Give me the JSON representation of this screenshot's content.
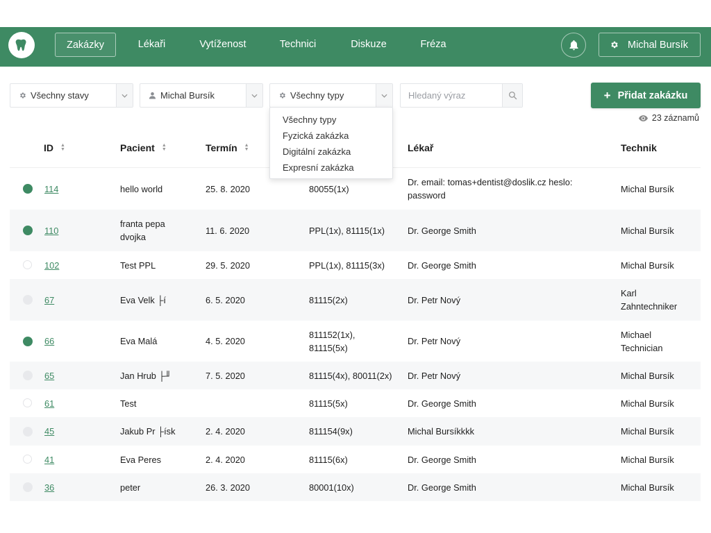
{
  "nav": {
    "logo_icon": "tooth-icon",
    "items": [
      "Zakázky",
      "Lékaři",
      "Vytíženost",
      "Technici",
      "Diskuze",
      "Fréza"
    ],
    "active_index": 0,
    "user": "Michal Bursík"
  },
  "filters": {
    "status": "Všechny stavy",
    "doctor": "Michal Bursík",
    "type": "Všechny typy",
    "search_placeholder": "Hledaný výraz",
    "add_button": "Přidat zakázku",
    "records": "23 záznamů"
  },
  "type_dropdown": {
    "open": true,
    "options": [
      "Všechny typy",
      "Fyzická zakázka",
      "Digitální zakázka",
      "Expresní zakázka"
    ]
  },
  "table": {
    "columns": [
      "ID",
      "Pacient",
      "Termín",
      "Lékař",
      "Technik"
    ],
    "rows": [
      {
        "status": "green",
        "id": "114",
        "patient": [
          "hello world"
        ],
        "date": "25. 8. 2020",
        "items": [
          "80055(1x)"
        ],
        "doctor": [
          "Dr. email: tomas+dentist@doslik.cz heslo:",
          "password"
        ],
        "technician": [
          "Michal Bursík"
        ]
      },
      {
        "status": "green",
        "id": "110",
        "patient": [
          "franta pepa",
          "dvojka"
        ],
        "date": "11. 6. 2020",
        "items": [
          "PPL(1x), 81115(1x)"
        ],
        "doctor": [
          "Dr. George Smith"
        ],
        "technician": [
          "Michal Bursík"
        ]
      },
      {
        "status": "outline",
        "id": "102",
        "patient": [
          "Test PPL"
        ],
        "date": "29. 5. 2020",
        "items": [
          "PPL(1x), 81115(3x)"
        ],
        "doctor": [
          "Dr. George Smith"
        ],
        "technician": [
          "Michal Bursík"
        ]
      },
      {
        "status": "grey",
        "id": "67",
        "patient": [
          "Eva Velk ├í"
        ],
        "date": "6. 5. 2020",
        "items": [
          "81115(2x)"
        ],
        "doctor": [
          "Dr. Petr Nový"
        ],
        "technician": [
          "Karl",
          "Zahntechniker"
        ]
      },
      {
        "status": "green",
        "id": "66",
        "patient": [
          "Eva Malá"
        ],
        "date": "4. 5. 2020",
        "items": [
          "811152(1x),",
          "81115(5x)"
        ],
        "doctor": [
          "Dr. Petr Nový"
        ],
        "technician": [
          "Michael",
          "Technician"
        ]
      },
      {
        "status": "grey",
        "id": "65",
        "patient": [
          "Jan Hrub ├╜"
        ],
        "date": "7. 5. 2020",
        "items": [
          "81115(4x), 80011(2x)"
        ],
        "doctor": [
          "Dr. Petr Nový"
        ],
        "technician": [
          "Michal Bursík"
        ]
      },
      {
        "status": "outline",
        "id": "61",
        "patient": [
          "Test"
        ],
        "date": "",
        "items": [
          "81115(5x)"
        ],
        "doctor": [
          "Dr. George Smith"
        ],
        "technician": [
          "Michal Bursík"
        ]
      },
      {
        "status": "grey",
        "id": "45",
        "patient": [
          "Jakub Pr ├ísk"
        ],
        "date": "2. 4. 2020",
        "items": [
          "811154(9x)"
        ],
        "doctor": [
          "Michal Bursíkkkk"
        ],
        "technician": [
          "Michal Bursík"
        ]
      },
      {
        "status": "outline",
        "id": "41",
        "patient": [
          "Eva Peres"
        ],
        "date": "2. 4. 2020",
        "items": [
          "81115(6x)"
        ],
        "doctor": [
          "Dr. George Smith"
        ],
        "technician": [
          "Michal Bursík"
        ]
      },
      {
        "status": "grey",
        "id": "36",
        "patient": [
          "peter"
        ],
        "date": "26. 3. 2020",
        "items": [
          "80001(10x)"
        ],
        "doctor": [
          "Dr. George Smith"
        ],
        "technician": [
          "Michal Bursík"
        ]
      }
    ]
  },
  "colors": {
    "brand": "#3e8a63",
    "row_alt": "#f6f7f8"
  }
}
